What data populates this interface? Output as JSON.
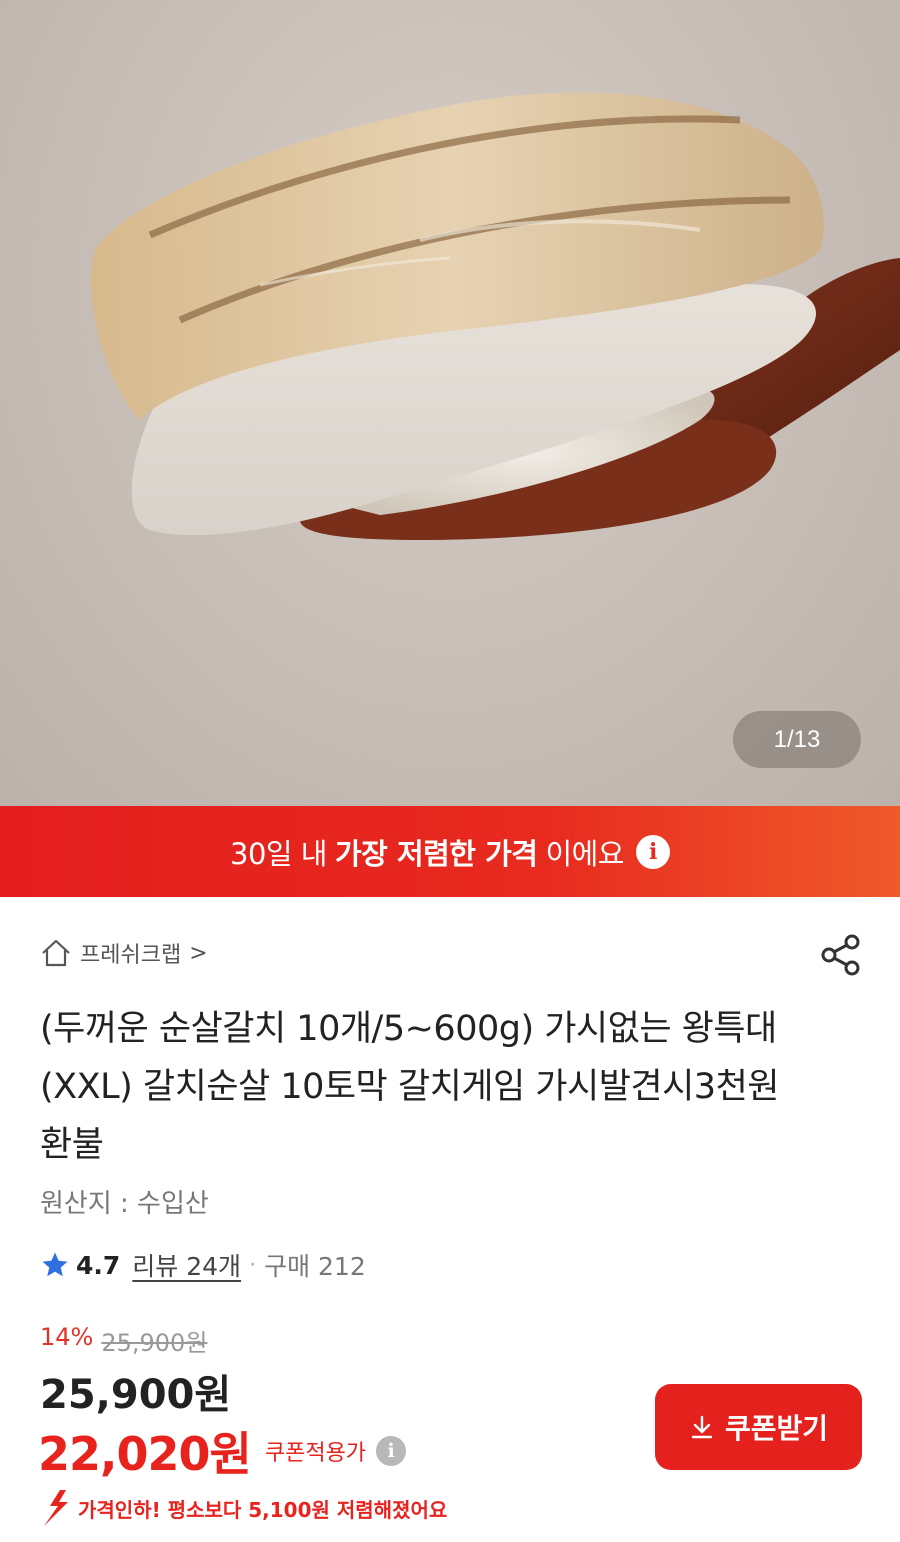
{
  "hero": {
    "image_alt": "",
    "counter": "1/13"
  },
  "banner": {
    "prefix": "30일 내",
    "highlight": "가장 저렴한 가격",
    "suffix": "이에요",
    "info_icon": "info-icon"
  },
  "store": {
    "name": "프레쉬크랩",
    "chevron": ">",
    "icon": "home-icon"
  },
  "share_icon": "share-icon",
  "product": {
    "title": "(두꺼운 순살갈치 10개/5~600g) 가시없는 왕특대(XXL) 갈치순살 10토막 갈치게임 가시발견시3천원환불",
    "origin": "원산지 : 수입산",
    "rating": "4.7",
    "reviews": "리뷰 24개",
    "separator": "·",
    "purchases": "구매 212"
  },
  "pricing": {
    "discount_pct": "14%",
    "original_price": "25,900원",
    "price": "25,900원",
    "coupon_price": "22,020원",
    "coupon_label": "쿠폰적용가",
    "coupon_button": "쿠폰받기",
    "price_drop_text": "가격인하! 평소보다 5,100원 저렴해졌어요"
  },
  "colors": {
    "accent": "#e4211d",
    "banner_start": "#e41e1e",
    "banner_end": "#ef5a2a"
  }
}
